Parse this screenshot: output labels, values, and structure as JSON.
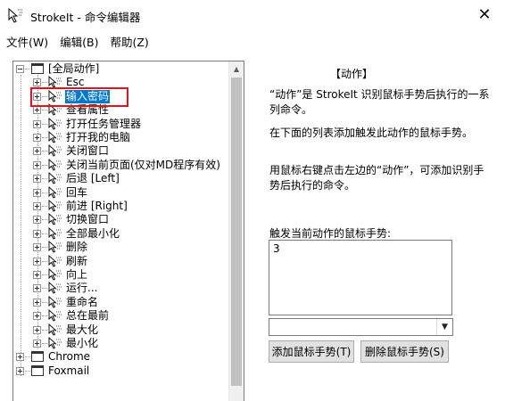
{
  "window": {
    "title": "StrokeIt - 命令编辑器",
    "close_glyph": "✕"
  },
  "menu": [
    {
      "label": "文件(W)"
    },
    {
      "label": "编辑(B)"
    },
    {
      "label": "帮助(Z)"
    }
  ],
  "tree": {
    "nodes": [
      {
        "label": "[全局动作]",
        "level": 0,
        "icon": "window-icon",
        "expander": "minus"
      },
      {
        "label": "Esc",
        "level": 1,
        "icon": "stroke-cursor-icon",
        "expander": "plus"
      },
      {
        "label": "输入密码",
        "level": 1,
        "icon": "stroke-cursor-icon",
        "expander": "plus",
        "selected": true
      },
      {
        "label": "查看属性",
        "level": 1,
        "icon": "stroke-cursor-icon",
        "expander": "plus"
      },
      {
        "label": "打开任务管理器",
        "level": 1,
        "icon": "stroke-cursor-icon",
        "expander": "plus"
      },
      {
        "label": "打开我的电脑",
        "level": 1,
        "icon": "stroke-cursor-icon",
        "expander": "plus"
      },
      {
        "label": "关闭窗口",
        "level": 1,
        "icon": "stroke-cursor-icon",
        "expander": "plus"
      },
      {
        "label": "关闭当前页面(仅对MD程序有效)",
        "level": 1,
        "icon": "stroke-cursor-icon",
        "expander": "plus"
      },
      {
        "label": "后退 [Left]",
        "level": 1,
        "icon": "stroke-cursor-icon",
        "expander": "plus"
      },
      {
        "label": "回车",
        "level": 1,
        "icon": "stroke-cursor-icon",
        "expander": "plus"
      },
      {
        "label": "前进 [Right]",
        "level": 1,
        "icon": "stroke-cursor-icon",
        "expander": "plus"
      },
      {
        "label": "切换窗口",
        "level": 1,
        "icon": "stroke-cursor-icon",
        "expander": "plus"
      },
      {
        "label": "全部最小化",
        "level": 1,
        "icon": "stroke-cursor-icon",
        "expander": "plus"
      },
      {
        "label": "删除",
        "level": 1,
        "icon": "stroke-cursor-icon",
        "expander": "plus"
      },
      {
        "label": "刷新",
        "level": 1,
        "icon": "stroke-cursor-icon",
        "expander": "plus"
      },
      {
        "label": "向上",
        "level": 1,
        "icon": "stroke-cursor-icon",
        "expander": "plus"
      },
      {
        "label": "运行...",
        "level": 1,
        "icon": "stroke-cursor-icon",
        "expander": "plus"
      },
      {
        "label": "重命名",
        "level": 1,
        "icon": "stroke-cursor-icon",
        "expander": "plus"
      },
      {
        "label": "总在最前",
        "level": 1,
        "icon": "stroke-cursor-icon",
        "expander": "plus"
      },
      {
        "label": "最大化",
        "level": 1,
        "icon": "stroke-cursor-icon",
        "expander": "plus"
      },
      {
        "label": "最小化",
        "level": 1,
        "icon": "stroke-cursor-icon",
        "expander": "plus"
      },
      {
        "label": "Chrome",
        "level": 0,
        "icon": "window-icon",
        "expander": "plus"
      },
      {
        "label": "Foxmail",
        "level": 0,
        "icon": "window-icon",
        "expander": "plus"
      }
    ]
  },
  "right": {
    "heading": "【动作】",
    "para1": "“动作”是 StrokeIt 识别鼠标手势后执行的一系列命令。",
    "para2": "在下面的列表添加触发此动作的鼠标手势。",
    "para3": "用鼠标右键点击左边的“动作”，可添加识别手势后执行的命令。",
    "gestures_label": "触发当前动作的鼠标手势:",
    "gestures": [
      "3"
    ],
    "combo_value": "",
    "add_button": "添加鼠标手势(T)",
    "delete_button": "删除鼠标手势(S)"
  },
  "colors": {
    "selection": "#0078d7",
    "highlight_box": "#e3131b"
  }
}
